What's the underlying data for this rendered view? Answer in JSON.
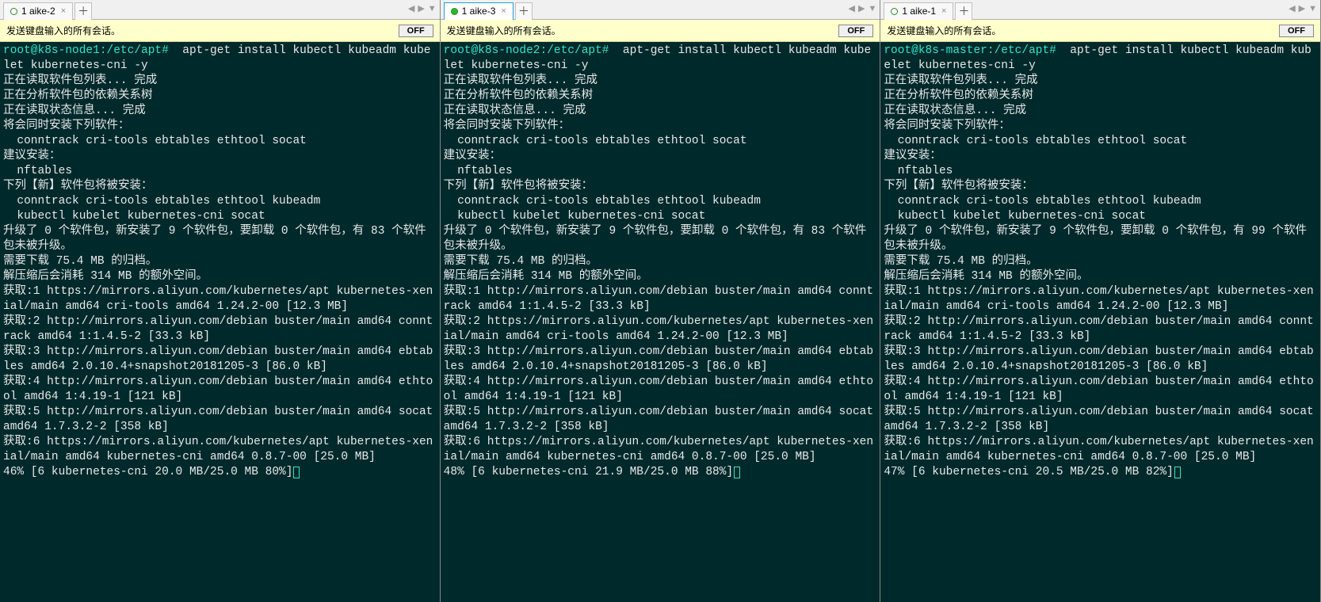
{
  "yellowbar": {
    "label": "发送键盘输入的所有会话。",
    "toggle": "OFF"
  },
  "nav": {
    "left": "◀",
    "right": "▶",
    "down": "▼"
  },
  "tab_add": "＋",
  "tab_close": "×",
  "panes": [
    {
      "tab_label": "1 aike-2",
      "active": false,
      "prompt": "root@k8s-node1:/etc/apt#",
      "command": "  apt-get install kubectl kubeadm kubelet kubernetes-cni -y",
      "body": "正在读取软件包列表... 完成\n正在分析软件包的依赖关系树\n正在读取状态信息... 完成\n将会同时安装下列软件：\n  conntrack cri-tools ebtables ethtool socat\n建议安装：\n  nftables\n下列【新】软件包将被安装：\n  conntrack cri-tools ebtables ethtool kubeadm\n  kubectl kubelet kubernetes-cni socat\n升级了 0 个软件包，新安装了 9 个软件包，要卸载 0 个软件包，有 83 个软件包未被升级。\n需要下载 75.4 MB 的归档。\n解压缩后会消耗 314 MB 的额外空间。\n获取:1 https://mirrors.aliyun.com/kubernetes/apt kubernetes-xenial/main amd64 cri-tools amd64 1.24.2-00 [12.3 MB]\n获取:2 http://mirrors.aliyun.com/debian buster/main amd64 conntrack amd64 1:1.4.5-2 [33.3 kB]\n获取:3 http://mirrors.aliyun.com/debian buster/main amd64 ebtables amd64 2.0.10.4+snapshot20181205-3 [86.0 kB]\n获取:4 http://mirrors.aliyun.com/debian buster/main amd64 ethtool amd64 1:4.19-1 [121 kB]\n获取:5 http://mirrors.aliyun.com/debian buster/main amd64 socat amd64 1.7.3.2-2 [358 kB]\n获取:6 https://mirrors.aliyun.com/kubernetes/apt kubernetes-xenial/main amd64 kubernetes-cni amd64 0.8.7-00 [25.0 MB]",
      "progress": "46% [6 kubernetes-cni 20.0 MB/25.0 MB 80%]"
    },
    {
      "tab_label": "1 aike-3",
      "active": true,
      "prompt": "root@k8s-node2:/etc/apt#",
      "command": "  apt-get install kubectl kubeadm kubelet kubernetes-cni -y",
      "body": "正在读取软件包列表... 完成\n正在分析软件包的依赖关系树\n正在读取状态信息... 完成\n将会同时安装下列软件：\n  conntrack cri-tools ebtables ethtool socat\n建议安装：\n  nftables\n下列【新】软件包将被安装：\n  conntrack cri-tools ebtables ethtool kubeadm\n  kubectl kubelet kubernetes-cni socat\n升级了 0 个软件包，新安装了 9 个软件包，要卸载 0 个软件包，有 83 个软件包未被升级。\n需要下载 75.4 MB 的归档。\n解压缩后会消耗 314 MB 的额外空间。\n获取:1 http://mirrors.aliyun.com/debian buster/main amd64 conntrack amd64 1:1.4.5-2 [33.3 kB]\n获取:2 https://mirrors.aliyun.com/kubernetes/apt kubernetes-xenial/main amd64 cri-tools amd64 1.24.2-00 [12.3 MB]\n获取:3 http://mirrors.aliyun.com/debian buster/main amd64 ebtables amd64 2.0.10.4+snapshot20181205-3 [86.0 kB]\n获取:4 http://mirrors.aliyun.com/debian buster/main amd64 ethtool amd64 1:4.19-1 [121 kB]\n获取:5 http://mirrors.aliyun.com/debian buster/main amd64 socat amd64 1.7.3.2-2 [358 kB]\n获取:6 https://mirrors.aliyun.com/kubernetes/apt kubernetes-xenial/main amd64 kubernetes-cni amd64 0.8.7-00 [25.0 MB]",
      "progress": "48% [6 kubernetes-cni 21.9 MB/25.0 MB 88%]"
    },
    {
      "tab_label": "1 aike-1",
      "active": false,
      "prompt": "root@k8s-master:/etc/apt#",
      "command": "  apt-get install kubectl kubeadm kubelet kubernetes-cni -y",
      "body": "正在读取软件包列表... 完成\n正在分析软件包的依赖关系树\n正在读取状态信息... 完成\n将会同时安装下列软件：\n  conntrack cri-tools ebtables ethtool socat\n建议安装：\n  nftables\n下列【新】软件包将被安装：\n  conntrack cri-tools ebtables ethtool kubeadm\n  kubectl kubelet kubernetes-cni socat\n升级了 0 个软件包，新安装了 9 个软件包，要卸载 0 个软件包，有 99 个软件包未被升级。\n需要下载 75.4 MB 的归档。\n解压缩后会消耗 314 MB 的额外空间。\n获取:1 https://mirrors.aliyun.com/kubernetes/apt kubernetes-xenial/main amd64 cri-tools amd64 1.24.2-00 [12.3 MB]\n获取:2 http://mirrors.aliyun.com/debian buster/main amd64 conntrack amd64 1:1.4.5-2 [33.3 kB]\n获取:3 http://mirrors.aliyun.com/debian buster/main amd64 ebtables amd64 2.0.10.4+snapshot20181205-3 [86.0 kB]\n获取:4 http://mirrors.aliyun.com/debian buster/main amd64 ethtool amd64 1:4.19-1 [121 kB]\n获取:5 http://mirrors.aliyun.com/debian buster/main amd64 socat amd64 1.7.3.2-2 [358 kB]\n获取:6 https://mirrors.aliyun.com/kubernetes/apt kubernetes-xenial/main amd64 kubernetes-cni amd64 0.8.7-00 [25.0 MB]",
      "progress": "47% [6 kubernetes-cni 20.5 MB/25.0 MB 82%]"
    }
  ]
}
